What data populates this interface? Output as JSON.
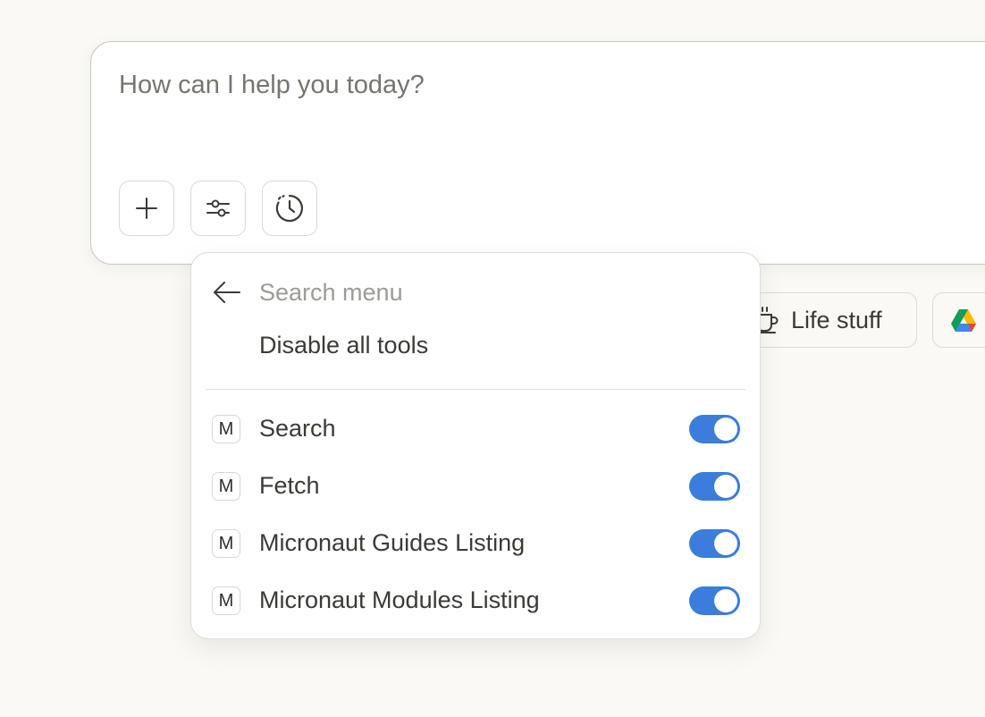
{
  "composer": {
    "placeholder": "How can I help you today?",
    "buttons": [
      {
        "icon": "plus-icon"
      },
      {
        "icon": "sliders-icon"
      },
      {
        "icon": "history-clock-icon"
      }
    ]
  },
  "chips": [
    {
      "icon": "coffee-cup-icon",
      "label": "Life stuff"
    },
    {
      "icon": "google-drive-icon",
      "label": ""
    }
  ],
  "menu": {
    "search_placeholder": "Search menu",
    "disable_all_label": "Disable all tools",
    "tools": [
      {
        "badge": "M",
        "name": "Search",
        "enabled": true
      },
      {
        "badge": "M",
        "name": "Fetch",
        "enabled": true
      },
      {
        "badge": "M",
        "name": "Micronaut Guides Listing",
        "enabled": true
      },
      {
        "badge": "M",
        "name": "Micronaut Modules Listing",
        "enabled": true
      }
    ]
  },
  "colors": {
    "background": "#faf9f5",
    "toggle_on": "#3b7ddb",
    "text": "#3b3a36"
  }
}
